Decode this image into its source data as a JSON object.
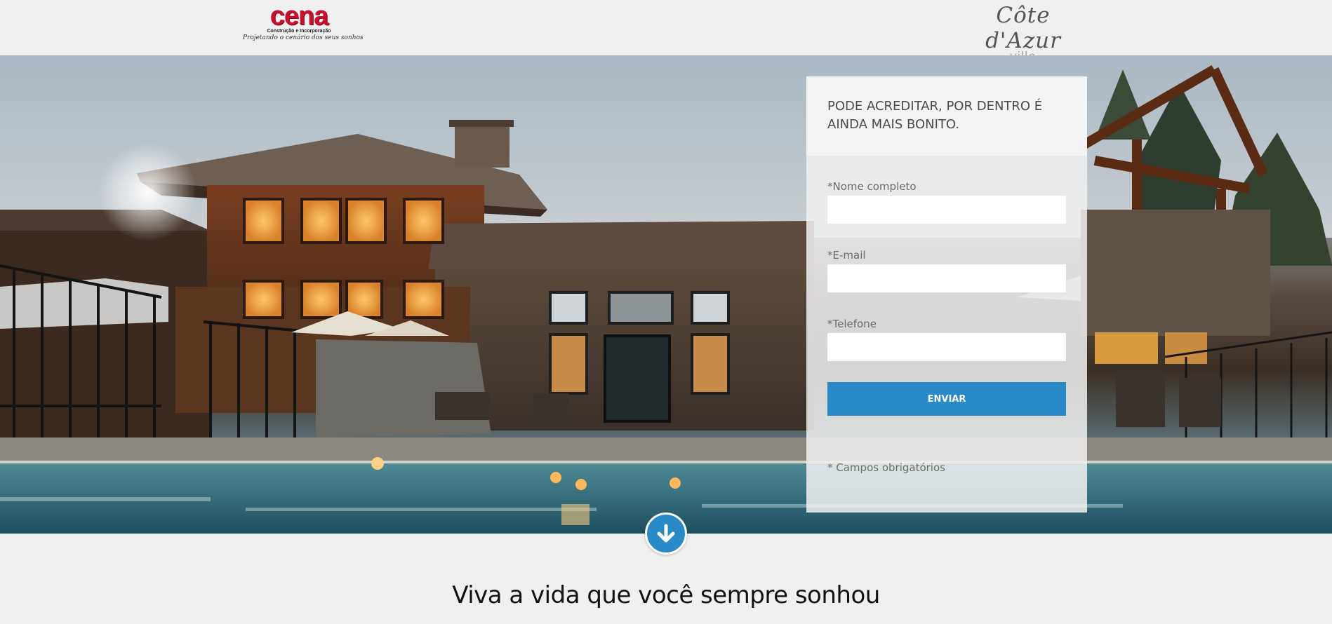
{
  "header": {
    "cena_logo": {
      "wordmark": "cena",
      "tagline": "Construção e Incorporação",
      "slogan": "Projetando o cenário dos seus sonhos"
    },
    "cote_logo": {
      "script": "Côte d'Azur",
      "sub": "ville"
    }
  },
  "hero": {
    "image": "luxury-lodge-with-pool-at-dusk"
  },
  "form": {
    "title": "PODE ACREDITAR, POR DENTRO É AINDA MAIS BONITO.",
    "fields": [
      {
        "label": "*Nome completo",
        "value": "",
        "placeholder": ""
      },
      {
        "label": "*E-mail",
        "value": "",
        "placeholder": ""
      },
      {
        "label": "*Telefone",
        "value": "",
        "placeholder": ""
      }
    ],
    "submit_label": "ENVIAR",
    "required_note": "* Campos obrigatórios"
  },
  "scroll_down": {
    "icon": "arrow-down-circle-icon"
  },
  "section": {
    "title": "Viva a vida que você sempre sonhou"
  },
  "colors": {
    "accent": "#2a8ac7",
    "brand_red": "#c8102e",
    "page_bg": "#f0f0f0"
  }
}
